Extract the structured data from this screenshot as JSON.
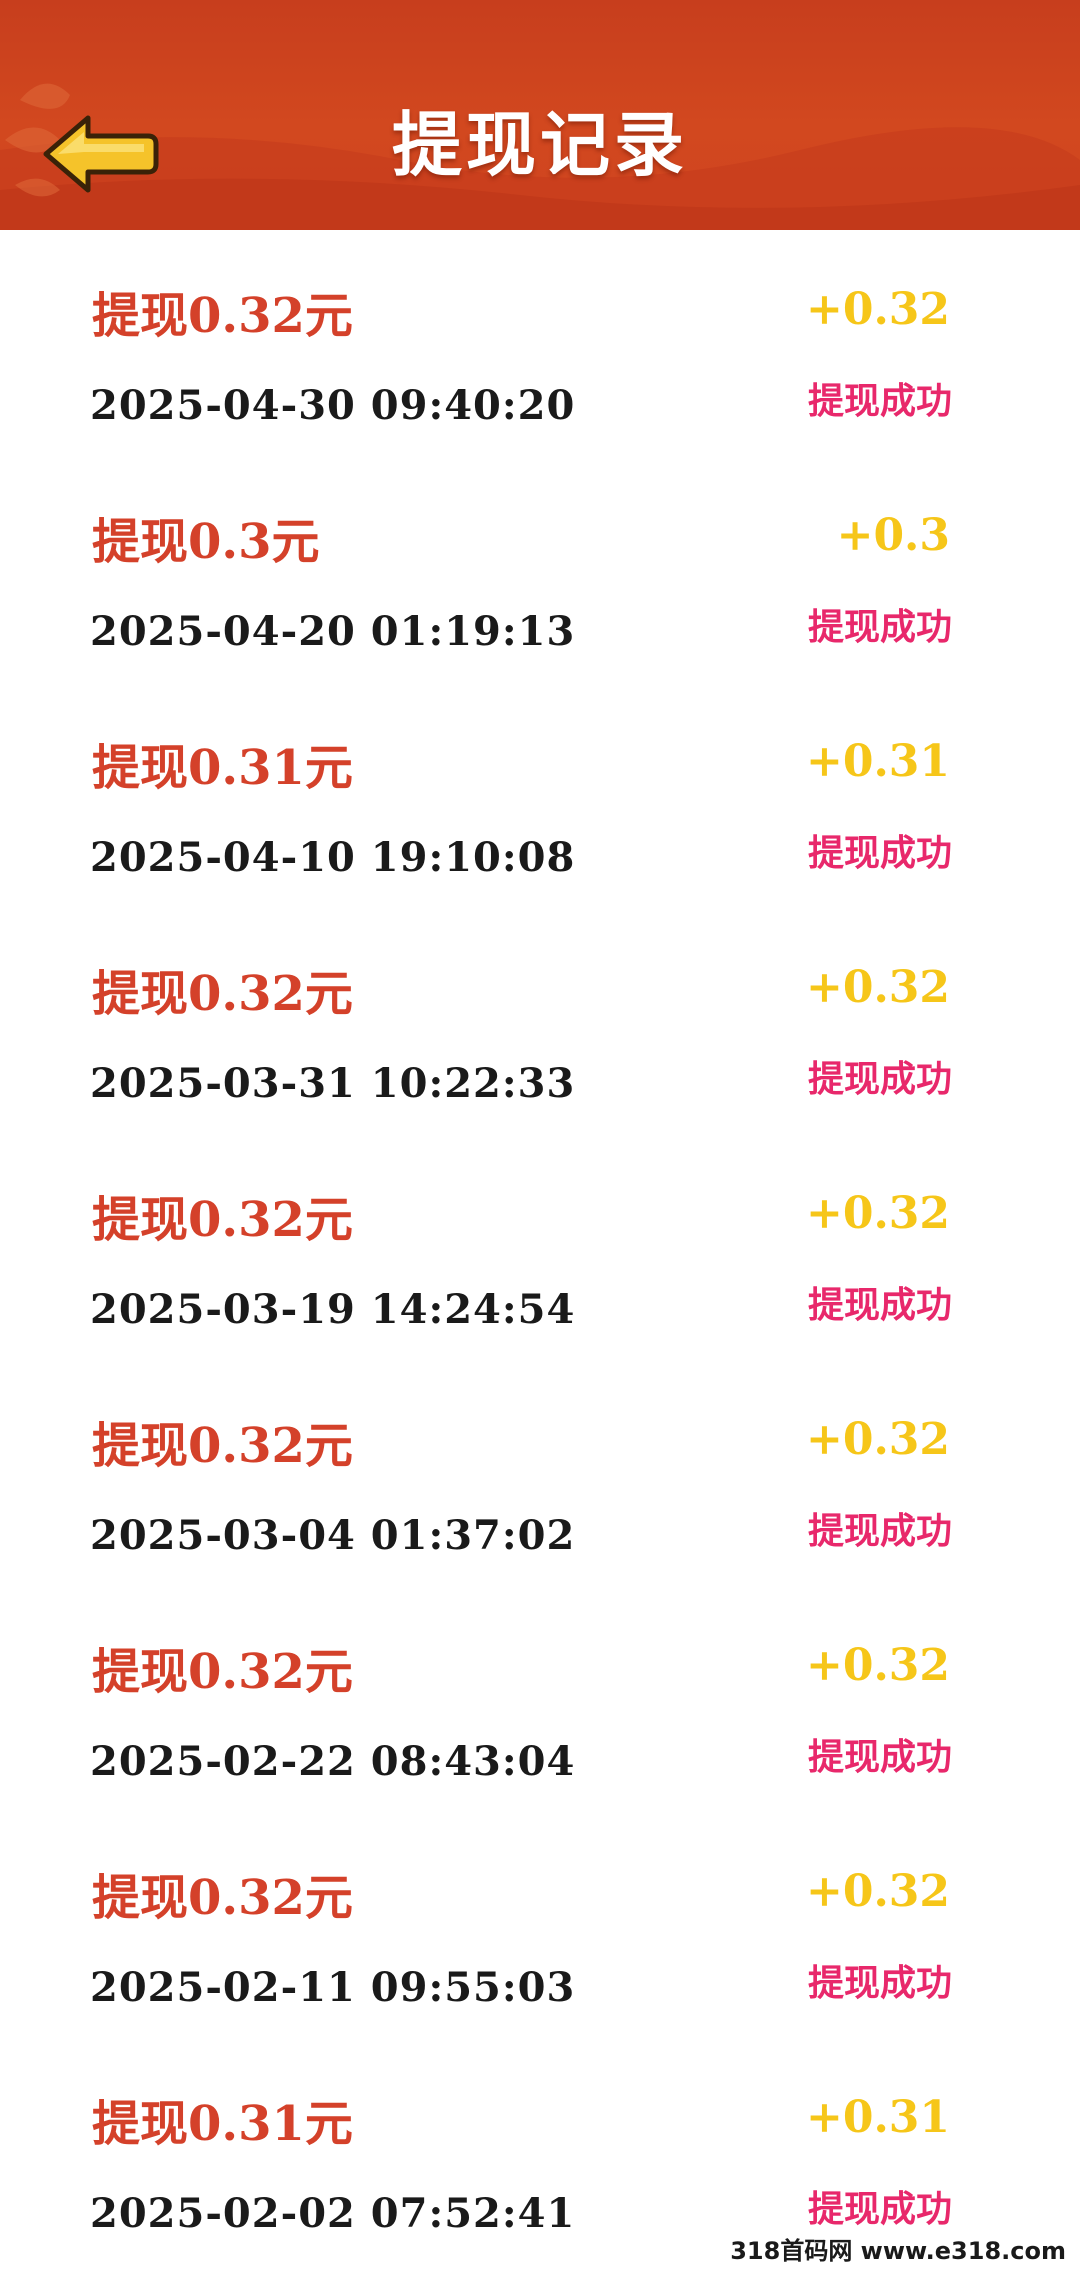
{
  "header": {
    "title": "提现记录",
    "back_icon": "back-arrow-icon",
    "bg_color": "#cd431f"
  },
  "colors": {
    "record_title": "#d4412a",
    "amount": "#f6c619",
    "timestamp": "#1a1a1a",
    "status": "#e8286b"
  },
  "records": [
    {
      "title": "提现0.32元",
      "amount": "+0.32",
      "time": "2025-04-30 09:40:20",
      "status": "提现成功"
    },
    {
      "title": "提现0.3元",
      "amount": "+0.3",
      "time": "2025-04-20 01:19:13",
      "status": "提现成功"
    },
    {
      "title": "提现0.31元",
      "amount": "+0.31",
      "time": "2025-04-10 19:10:08",
      "status": "提现成功"
    },
    {
      "title": "提现0.32元",
      "amount": "+0.32",
      "time": "2025-03-31 10:22:33",
      "status": "提现成功"
    },
    {
      "title": "提现0.32元",
      "amount": "+0.32",
      "time": "2025-03-19 14:24:54",
      "status": "提现成功"
    },
    {
      "title": "提现0.32元",
      "amount": "+0.32",
      "time": "2025-03-04 01:37:02",
      "status": "提现成功"
    },
    {
      "title": "提现0.32元",
      "amount": "+0.32",
      "time": "2025-02-22 08:43:04",
      "status": "提现成功"
    },
    {
      "title": "提现0.32元",
      "amount": "+0.32",
      "time": "2025-02-11 09:55:03",
      "status": "提现成功"
    },
    {
      "title": "提现0.31元",
      "amount": "+0.31",
      "time": "2025-02-02 07:52:41",
      "status": "提现成功"
    }
  ],
  "watermark": "318首码网 www.e318.com"
}
